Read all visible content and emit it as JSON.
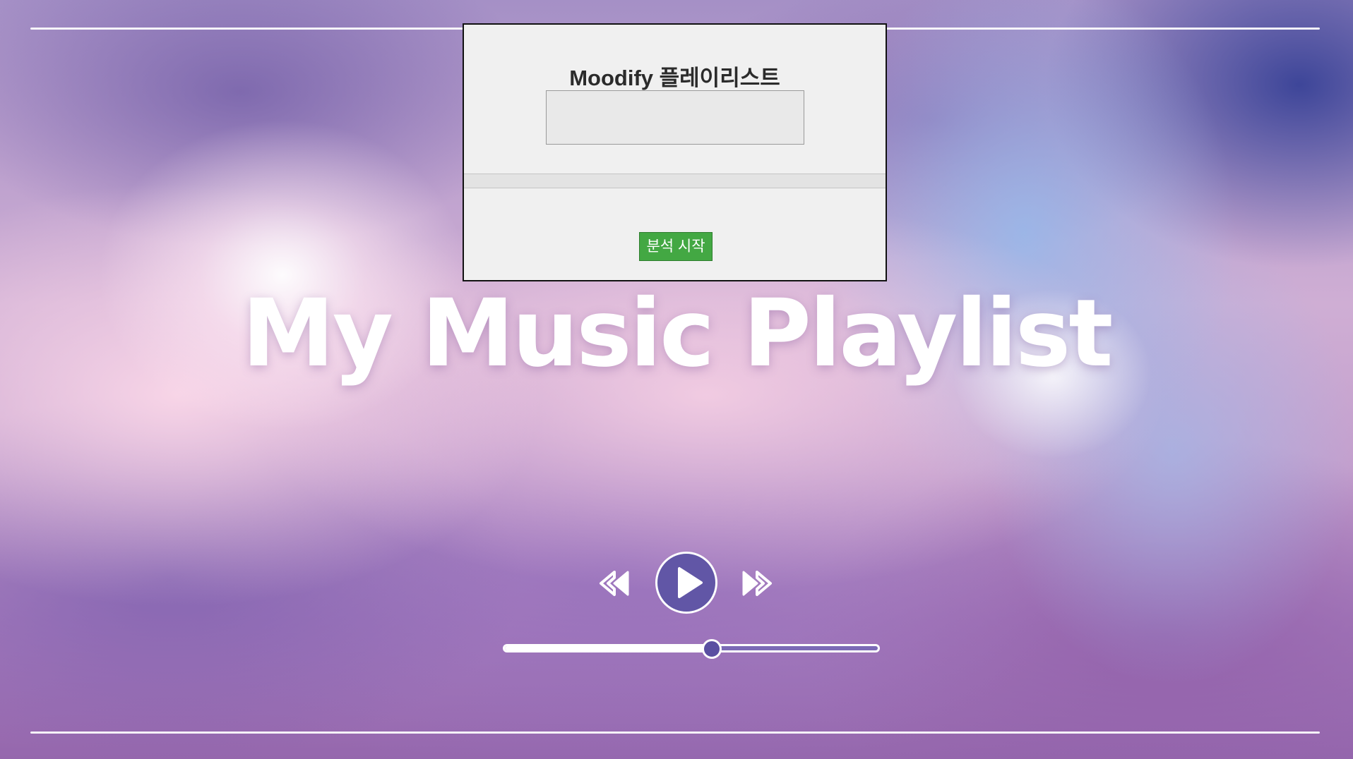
{
  "dialog": {
    "title": "Moodify 플레이리스트",
    "input_value": "",
    "start_button_label": "분석 시작"
  },
  "hero": {
    "title": "My Music Playlist"
  },
  "player": {
    "prev_icon": "rewind-icon",
    "play_icon": "play-icon",
    "next_icon": "fast-forward-icon",
    "progress": 0.555
  },
  "colors": {
    "button_green": "#43a843",
    "player_purple": "#6156a6"
  }
}
